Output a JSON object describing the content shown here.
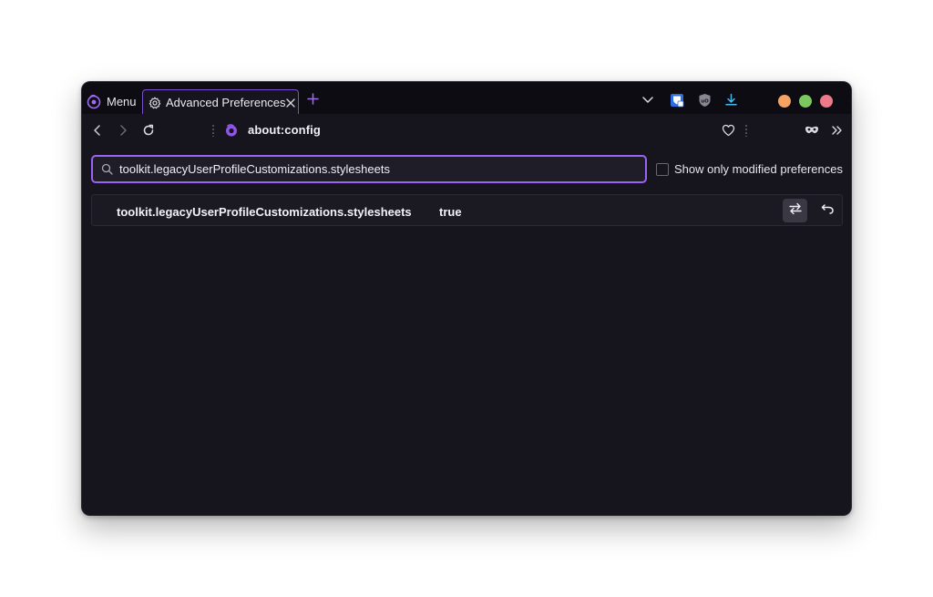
{
  "menu": {
    "label": "Menu"
  },
  "tab": {
    "title": "Advanced Preferences",
    "icon": "gear-icon"
  },
  "toolbar": {
    "icons": [
      "list-all-tabs-icon",
      "bitwarden-icon",
      "ublock-origin-icon",
      "download-icon"
    ]
  },
  "window_controls": {
    "colors": [
      "#f5a262",
      "#7dc75f",
      "#f07a8a"
    ]
  },
  "nav": {
    "url": "about:config",
    "icons": [
      "back-icon",
      "forward-icon",
      "reload-icon",
      "firefox-icon",
      "heart-icon",
      "private-mask-icon",
      "overflow-menu-icon"
    ]
  },
  "search": {
    "value": "toolkit.legacyUserProfileCustomizations.stylesheets",
    "placeholder": ""
  },
  "filter": {
    "label": "Show only modified preferences",
    "checked": false
  },
  "preference": {
    "name": "toolkit.legacyUserProfileCustomizations.stylesheets",
    "value": "true"
  },
  "colors": {
    "accent": "#9b64f0",
    "background": "#16141d",
    "tabbar": "#0d0c12"
  }
}
